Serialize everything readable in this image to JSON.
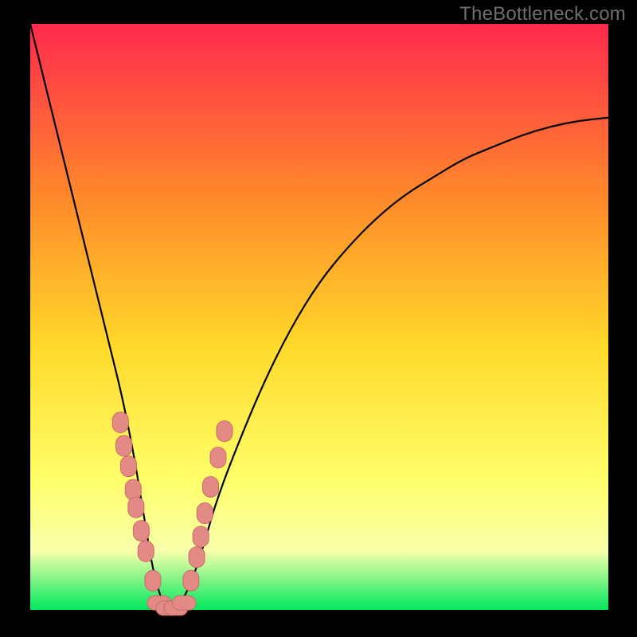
{
  "watermark": "TheBottleneck.com",
  "colors": {
    "background": "#000000",
    "gradient_top": "#ff2a4d",
    "gradient_mid1": "#ff8a2a",
    "gradient_mid2": "#ffd92a",
    "gradient_mid3": "#ffff6a",
    "gradient_band": "#f7ffaa",
    "gradient_bottom": "#00e85e",
    "curve": "#000000",
    "marker_fill": "#e48a86",
    "marker_stroke": "#c96b67"
  },
  "chart_data": {
    "type": "line",
    "title": "",
    "xlabel": "",
    "ylabel": "",
    "xlim": [
      0,
      100
    ],
    "ylim": [
      0,
      100
    ],
    "grid": false,
    "legend": false,
    "series": [
      {
        "name": "bottleneck-curve",
        "x": [
          0,
          2,
          4,
          6,
          8,
          10,
          12,
          14,
          16,
          18,
          19,
          20,
          21,
          22,
          23,
          24,
          25,
          26,
          28,
          30,
          32,
          35,
          40,
          45,
          50,
          55,
          60,
          65,
          70,
          75,
          80,
          85,
          90,
          95,
          100
        ],
        "y": [
          100,
          92,
          84,
          76,
          68,
          60,
          52,
          44,
          36,
          26,
          20,
          14,
          8,
          4,
          1,
          0,
          0,
          1,
          5,
          11,
          18,
          26,
          38,
          48,
          56,
          62,
          67,
          71,
          74,
          77,
          79,
          81,
          82.5,
          83.5,
          84
        ]
      }
    ],
    "markers": [
      {
        "x": 15.6,
        "y": 32.0
      },
      {
        "x": 16.2,
        "y": 28.0
      },
      {
        "x": 17.0,
        "y": 24.5
      },
      {
        "x": 17.8,
        "y": 20.5
      },
      {
        "x": 18.3,
        "y": 17.5
      },
      {
        "x": 19.2,
        "y": 13.5
      },
      {
        "x": 20.0,
        "y": 10.0
      },
      {
        "x": 21.2,
        "y": 5.0
      },
      {
        "x": 22.3,
        "y": 1.2
      },
      {
        "x": 23.8,
        "y": 0.3
      },
      {
        "x": 25.2,
        "y": 0.3
      },
      {
        "x": 26.6,
        "y": 1.2
      },
      {
        "x": 27.8,
        "y": 5.0
      },
      {
        "x": 28.8,
        "y": 9.0
      },
      {
        "x": 29.5,
        "y": 12.5
      },
      {
        "x": 30.2,
        "y": 16.5
      },
      {
        "x": 31.2,
        "y": 21.0
      },
      {
        "x": 32.5,
        "y": 26.0
      },
      {
        "x": 33.6,
        "y": 30.5
      }
    ],
    "annotations": []
  }
}
